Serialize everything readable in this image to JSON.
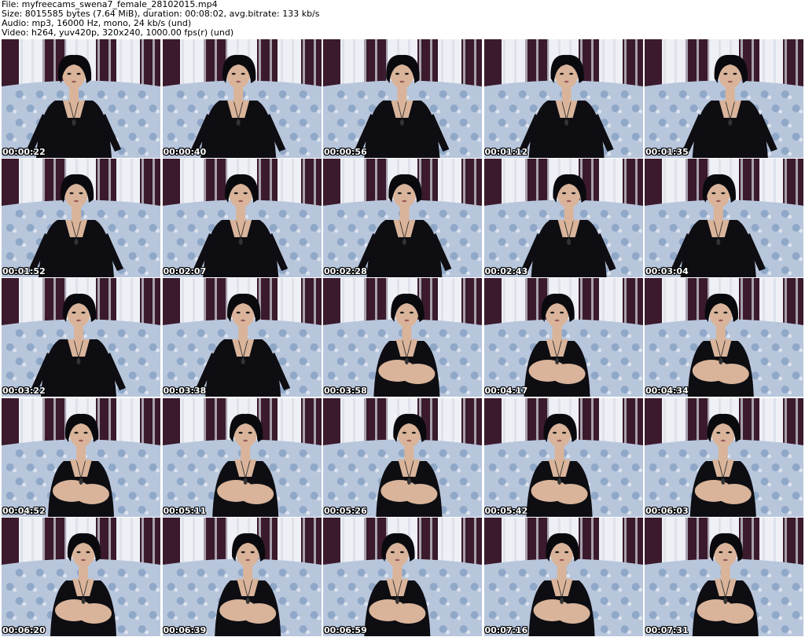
{
  "header": {
    "file_line": "File: myfreecams_swena7_female_28102015.mp4",
    "size_line": "Size: 8015585 bytes (7.64 MiB), duration: 00:08:02, avg.bitrate: 133 kb/s",
    "audio_line": "Audio: mp3, 16000 Hz, mono, 24 kb/s (und)",
    "video_line": "Video: h264, yuv420p, 320x240, 1000.00 fps(r) (und)"
  },
  "thumbnails": [
    {
      "timestamp": "00:00:22"
    },
    {
      "timestamp": "00:00:40"
    },
    {
      "timestamp": "00:00:56"
    },
    {
      "timestamp": "00:01:12"
    },
    {
      "timestamp": "00:01:35"
    },
    {
      "timestamp": "00:01:52"
    },
    {
      "timestamp": "00:02:07"
    },
    {
      "timestamp": "00:02:28"
    },
    {
      "timestamp": "00:02:43"
    },
    {
      "timestamp": "00:03:04"
    },
    {
      "timestamp": "00:03:22"
    },
    {
      "timestamp": "00:03:38"
    },
    {
      "timestamp": "00:03:58"
    },
    {
      "timestamp": "00:04:17"
    },
    {
      "timestamp": "00:04:34"
    },
    {
      "timestamp": "00:04:52"
    },
    {
      "timestamp": "00:05:11"
    },
    {
      "timestamp": "00:05:26"
    },
    {
      "timestamp": "00:05:42"
    },
    {
      "timestamp": "00:06:03"
    },
    {
      "timestamp": "00:06:20"
    },
    {
      "timestamp": "00:06:39"
    },
    {
      "timestamp": "00:06:59"
    },
    {
      "timestamp": "00:07:16"
    },
    {
      "timestamp": "00:07:31"
    }
  ],
  "colors": {
    "page_background": "#ffffff",
    "curtain_white": "#eef0f5",
    "curtain_dark": "#3a1a2c",
    "couch_fabric": "#b8c6dc",
    "couch_flower": "#6f8fb8",
    "dress": "#0d0d12",
    "skin": "#d9b49a",
    "hair": "#0a0a0e"
  }
}
